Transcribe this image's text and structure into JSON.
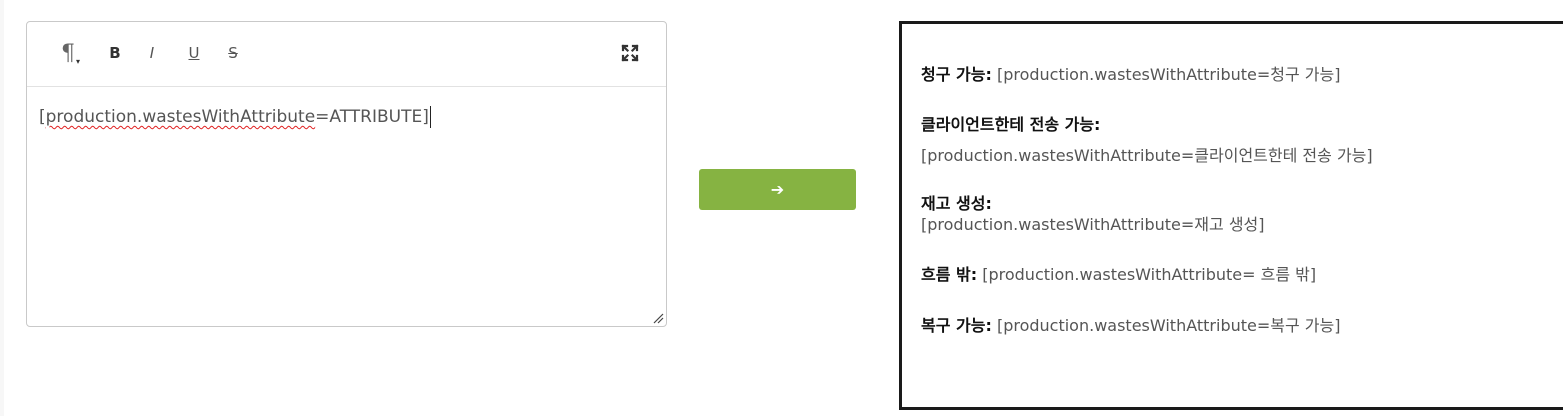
{
  "editor": {
    "toolbar": {
      "paragraph_icon": "¶",
      "paragraph_caret": "▾",
      "bold": "B",
      "italic": "I",
      "underline": "U",
      "strikethrough": "S"
    },
    "content": {
      "open_bracket": "[",
      "token_spelled": "production.wastesWithAttribute",
      "token_rest": "=ATTRIBUTE]"
    }
  },
  "convert_button": {
    "arrow": "➔"
  },
  "preview": {
    "items": [
      {
        "label": "청구 가능:",
        "value": "[production.wastesWithAttribute=청구 가능]"
      },
      {
        "label": "클라이언트한테 전송 가능:",
        "value": "[production.wastesWithAttribute=클라이언트한테 전송 가능]"
      },
      {
        "label": "재고 생성:",
        "value": "[production.wastesWithAttribute=재고 생성]"
      },
      {
        "label": "흐름 밖:",
        "value": "[production.wastesWithAttribute= 흐름 밖]"
      },
      {
        "label": "복구 가능:",
        "value": "[production.wastesWithAttribute=복구 가능]"
      }
    ]
  },
  "colors": {
    "button_green": "#86b342",
    "spellcheck_red": "#e02020",
    "preview_border": "#1a1a1a"
  }
}
